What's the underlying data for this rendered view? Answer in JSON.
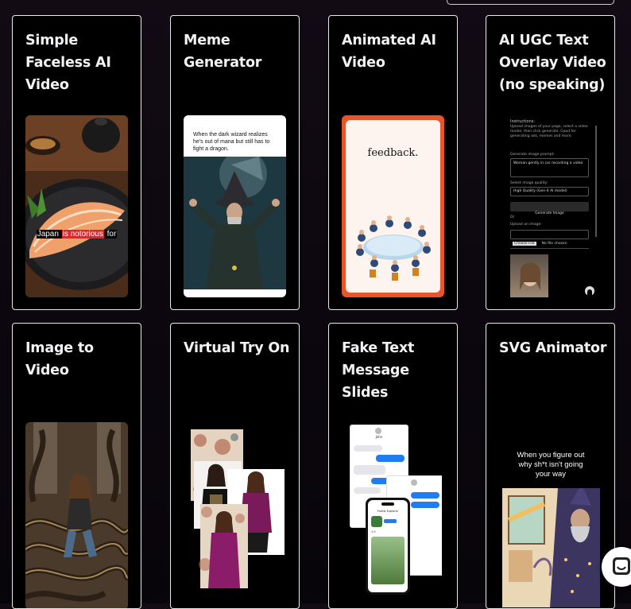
{
  "cards": [
    {
      "title": "Simple Faceless AI Video",
      "thumb": {
        "caption_pre": "Japan ",
        "caption_mid": "is notorious",
        "caption_post": " for"
      }
    },
    {
      "title": "Meme Generator",
      "thumb": {
        "meme_text": "When the dark wizard realizes he's out of mana but still has to fight a dragon."
      }
    },
    {
      "title": "Animated AI Video",
      "thumb": {
        "word": "feedback."
      }
    },
    {
      "title": "AI UGC Text Overlay Video (no speaking)",
      "thumb": {
        "instructions_label": "Instructions:",
        "instructions_text": "Upload images of your page, select a video model, then click generate. Good for generating ads, memes and more.",
        "prompt_label": "Generate image prompt:",
        "prompt_value": "Woman gently in car recording a video",
        "quality_label": "Select image quality:",
        "quality_value": "High Quality (Gen-4 AI model)",
        "generate_button": "Generate Image",
        "or_label": "Or",
        "upload_label": "Upload an image:",
        "choose_file_button": "Choose File",
        "no_file_text": "No file chosen"
      }
    },
    {
      "title": "Image to Video"
    },
    {
      "title": "Virtual Try On"
    },
    {
      "title": "Fake Text Message Slides",
      "thumb": {
        "contact_name": "John",
        "app_title": "Forest Explorer",
        "app_rating": "4.8"
      }
    },
    {
      "title": "SVG Animator",
      "thumb": {
        "caption": "When you figure out why sh*t isn't going your way"
      }
    }
  ],
  "colors": {
    "page_bg": "#0b060e",
    "card_bg": "#000000",
    "card_border": "#e9e9ee",
    "title_text": "#f2f2f5",
    "highlight_red": "#e8222b",
    "frame_orange": "#e8552b"
  },
  "icons": {
    "chat": "chat-bubble-icon",
    "record": "record-icon"
  }
}
